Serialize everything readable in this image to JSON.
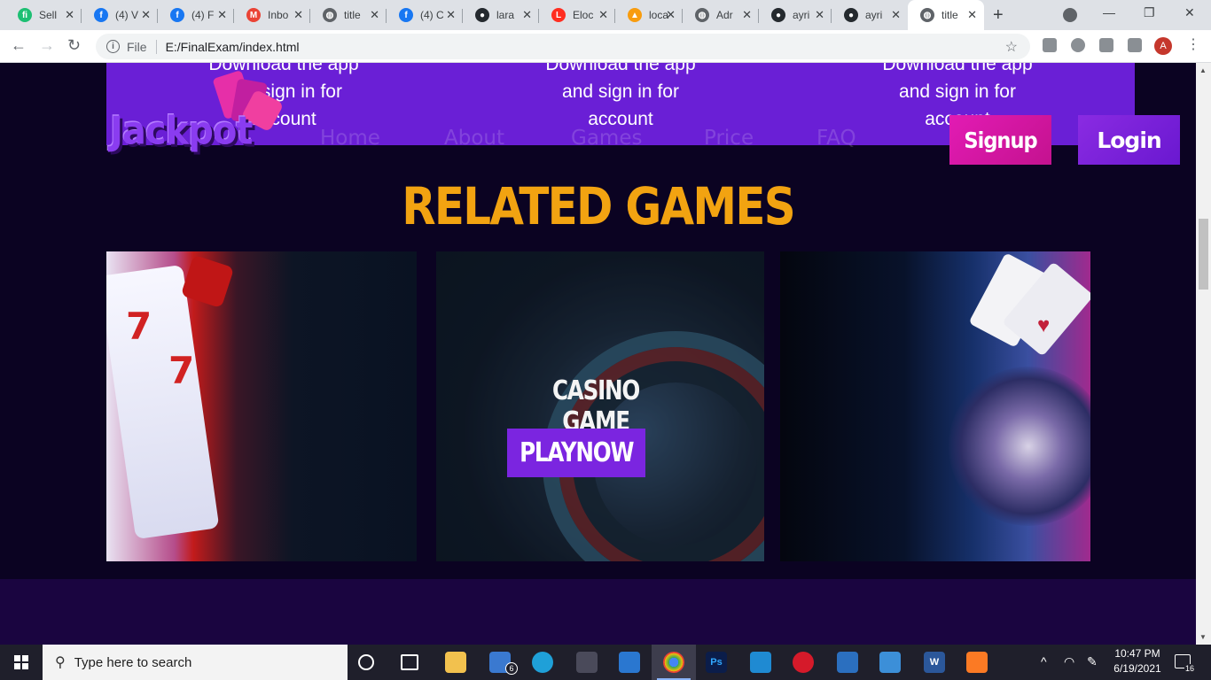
{
  "browser": {
    "tabs": [
      {
        "title": "Sell",
        "icon": "fiverr-icon",
        "color": "#1dbf73",
        "glyph": "fi"
      },
      {
        "title": "(4) V",
        "icon": "facebook-icon",
        "color": "#1877f2",
        "glyph": "f"
      },
      {
        "title": "(4) F",
        "icon": "facebook-icon",
        "color": "#1877f2",
        "glyph": "f"
      },
      {
        "title": "Inbo",
        "icon": "gmail-icon",
        "color": "#ea4335",
        "glyph": "M"
      },
      {
        "title": "title",
        "icon": "globe-icon",
        "color": "#5f6368",
        "glyph": "◍"
      },
      {
        "title": "(4) C",
        "icon": "facebook-icon",
        "color": "#1877f2",
        "glyph": "f"
      },
      {
        "title": "lara",
        "icon": "github-icon",
        "color": "#24292e",
        "glyph": "●"
      },
      {
        "title": "Eloc",
        "icon": "laravel-icon",
        "color": "#ff2d20",
        "glyph": "L"
      },
      {
        "title": "loca",
        "icon": "phpmyadmin-icon",
        "color": "#f89c0e",
        "glyph": "▲"
      },
      {
        "title": "Adr",
        "icon": "globe-icon",
        "color": "#5f6368",
        "glyph": "◍"
      },
      {
        "title": "ayri",
        "icon": "github-icon",
        "color": "#24292e",
        "glyph": "●"
      },
      {
        "title": "ayri",
        "icon": "github-icon",
        "color": "#24292e",
        "glyph": "●"
      },
      {
        "title": "title",
        "icon": "globe-icon",
        "color": "#5f6368",
        "glyph": "◍"
      }
    ],
    "active_tab_index": 12,
    "url_scheme": "File",
    "url": "E:/FinalExam/index.html"
  },
  "page": {
    "download_text": [
      "Download the app",
      "and sign in for",
      "account"
    ],
    "logo": "Jackpot",
    "nav": [
      "Home",
      "About",
      "Games",
      "Price",
      "FAQ"
    ],
    "signup_label": "Signup",
    "login_label": "Login",
    "section_title": "RELATED GAMES",
    "featured_card": {
      "title": "CASINO GAME",
      "button": "PLAYNOW"
    },
    "colors": {
      "accent_purple": "#6a1fd6",
      "signup_pink": "#e21bb4",
      "title_orange": "#f2a311",
      "background": "#0b0322"
    }
  },
  "taskbar": {
    "search_placeholder": "Type here to search",
    "time": "10:47 PM",
    "date": "6/19/2021",
    "mail_badge": "6",
    "notification_count": "16"
  }
}
